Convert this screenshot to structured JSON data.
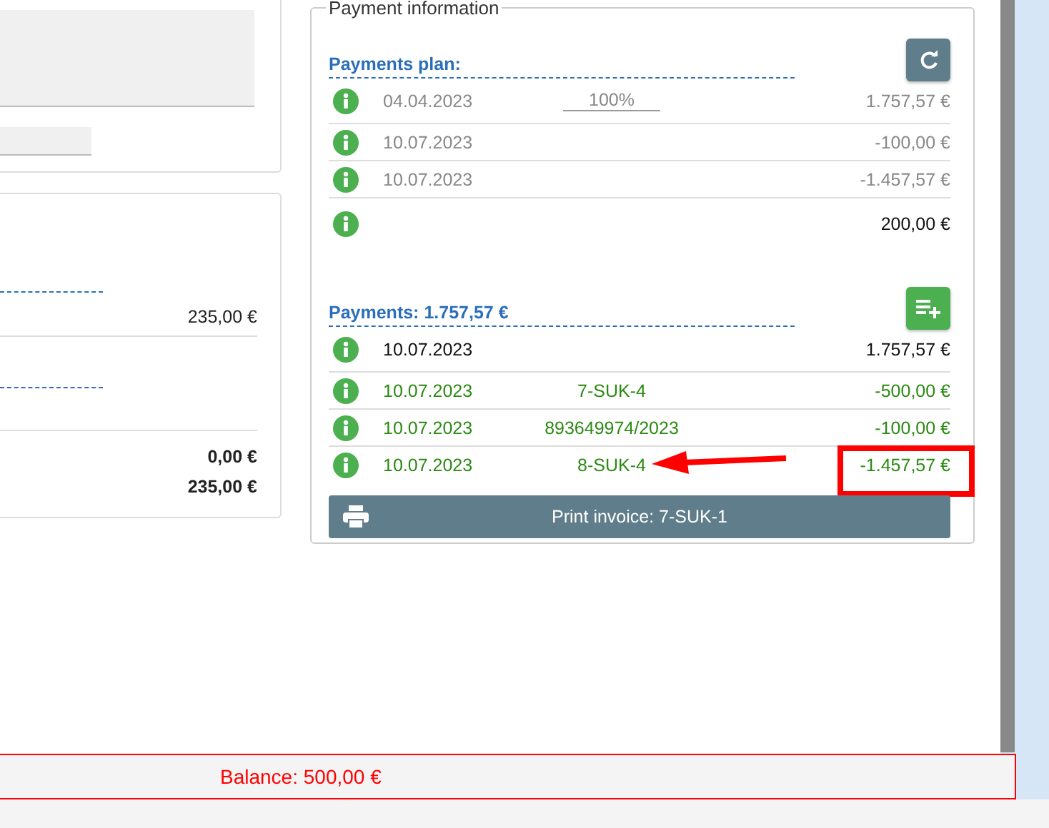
{
  "summary_card": {
    "subtotal": "235,00 €",
    "totals": [
      "0,00 €",
      "235,00 €"
    ]
  },
  "payment_information": {
    "legend": "Payment information",
    "plan": {
      "title": "Payments plan:",
      "rows": [
        {
          "kind": "entry",
          "date": "04.04.2023",
          "percent": "100%",
          "amount": "1.757,57 €"
        },
        {
          "kind": "entry",
          "date": "10.07.2023",
          "amount": "-100,00 €"
        },
        {
          "kind": "entry",
          "date": "10.07.2023",
          "amount": "-1.457,57 €"
        },
        {
          "kind": "total",
          "amount": "200,00 €"
        }
      ]
    },
    "payments": {
      "title": "Payments: 1.757,57 €",
      "rows": [
        {
          "kind": "total",
          "date": "10.07.2023",
          "amount": "1.757,57 €",
          "highlighted": false
        },
        {
          "kind": "booked",
          "date": "10.07.2023",
          "document": "7-SUK-4",
          "amount": "-500,00 €",
          "highlighted": false
        },
        {
          "kind": "booked",
          "date": "10.07.2023",
          "document": "893649974/2023",
          "amount": "-100,00 €",
          "highlighted": false
        },
        {
          "kind": "booked",
          "date": "10.07.2023",
          "document": "8-SUK-4",
          "amount": "-1.457,57 €",
          "highlighted": true
        }
      ]
    },
    "print_button": "Print invoice: 7-SUK-1"
  },
  "balance": "Balance: 500,00 €"
}
